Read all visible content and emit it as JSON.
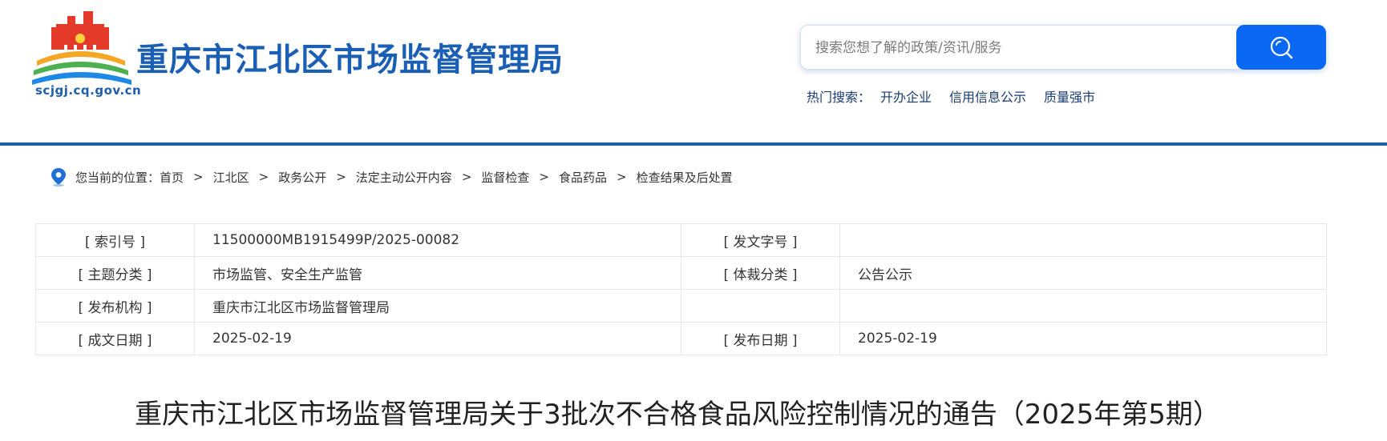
{
  "header": {
    "site_title": "重庆市江北区市场监督管理局",
    "domain": "scjgj.cq.gov.cn",
    "search": {
      "placeholder": "搜索您想了解的政策/资讯/服务"
    },
    "hot_search": {
      "label": "热门搜索：",
      "items": [
        "开办企业",
        "信用信息公示",
        "质量强市"
      ]
    }
  },
  "breadcrumb": {
    "prefix": "您当前的位置：",
    "items": [
      "首页",
      "江北区",
      "政务公开",
      "法定主动公开内容",
      "监督检查",
      "食品药品",
      "检查结果及后处置"
    ],
    "separator": ">"
  },
  "meta": {
    "rows": [
      {
        "label1": "[ 索引号 ]",
        "value1": "11500000MB1915499P/2025-00082",
        "label2": "[ 发文字号 ]",
        "value2": ""
      },
      {
        "label1": "[ 主题分类 ]",
        "value1": "市场监管、安全生产监管",
        "label2": "[ 体裁分类 ]",
        "value2": "公告公示"
      },
      {
        "label1": "[ 发布机构 ]",
        "value1": "重庆市江北区市场监督管理局",
        "label2": "",
        "value2": ""
      },
      {
        "label1": "[ 成文日期 ]",
        "value1": "2025-02-19",
        "label2": "[ 发布日期 ]",
        "value2": "2025-02-19"
      }
    ]
  },
  "article": {
    "title": "重庆市江北区市场监督管理局关于3批次不合格食品风险控制情况的通告（2025年第5期）"
  },
  "colors": {
    "brand_blue": "#1a5fb4",
    "search_button": "#0a68f5",
    "divider": "#1f5fa8"
  }
}
